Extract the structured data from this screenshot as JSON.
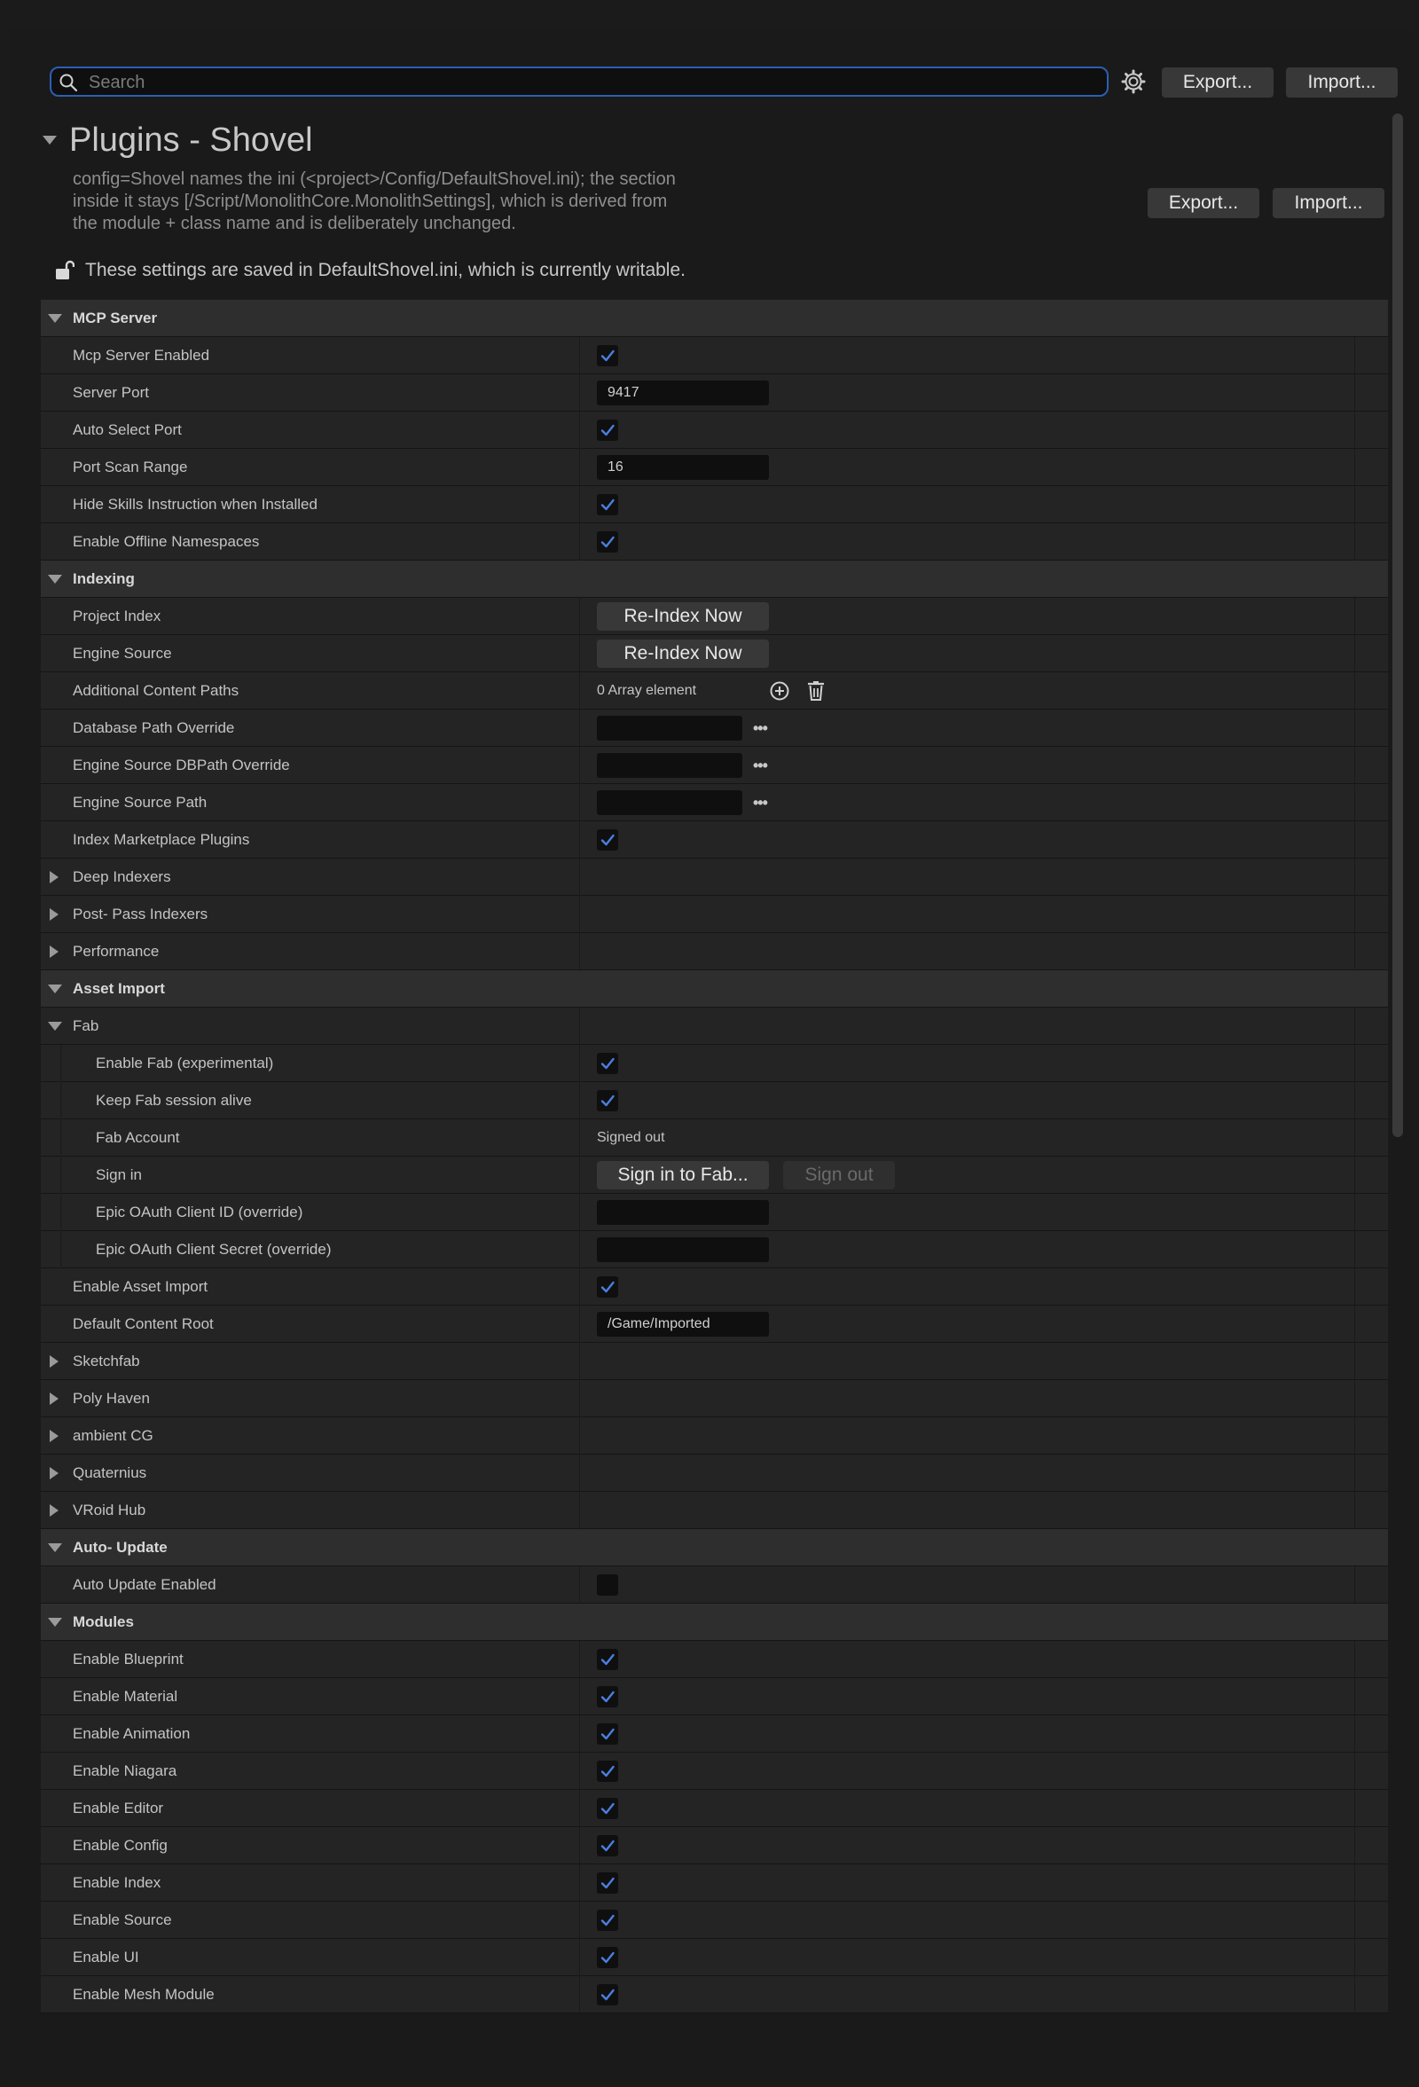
{
  "search": {
    "placeholder": "Search",
    "value": ""
  },
  "toolbar": {
    "export_label": "Export...",
    "import_label": "Import..."
  },
  "header": {
    "title": "Plugins - Shovel",
    "description_lines": [
      "config=Shovel names the ini (<project>/Config/DefaultShovel.ini); the section",
      "inside it stays [/Script/MonolithCore.MonolithSettings], which is derived from",
      "the module + class name and is deliberately unchanged."
    ],
    "export_label": "Export...",
    "import_label": "Import...",
    "saved_note": "These settings are saved in DefaultShovel.ini, which is currently writable."
  },
  "colors": {
    "accent": "#2c5fb3",
    "check": "#4a7fe0"
  },
  "rows": [
    {
      "type": "category",
      "label": "MCP Server",
      "expanded": true
    },
    {
      "type": "checkbox",
      "label": "Mcp Server Enabled",
      "checked": true
    },
    {
      "type": "text",
      "label": "Server Port",
      "value": "9417"
    },
    {
      "type": "checkbox",
      "label": "Auto Select Port",
      "checked": true
    },
    {
      "type": "text",
      "label": "Port Scan Range",
      "value": "16"
    },
    {
      "type": "checkbox",
      "label": "Hide Skills Instruction when Installed",
      "checked": true
    },
    {
      "type": "checkbox",
      "label": "Enable Offline Namespaces",
      "checked": true
    },
    {
      "type": "category",
      "label": "Indexing",
      "expanded": true
    },
    {
      "type": "button",
      "label": "Project Index",
      "button": "Re-Index Now"
    },
    {
      "type": "button",
      "label": "Engine Source",
      "button": "Re-Index Now"
    },
    {
      "type": "array",
      "label": "Additional Content Paths",
      "value": "0 Array element"
    },
    {
      "type": "path",
      "label": "Database Path Override"
    },
    {
      "type": "path",
      "label": "Engine Source DBPath Override"
    },
    {
      "type": "path",
      "label": "Engine Source Path"
    },
    {
      "type": "checkbox",
      "label": "Index Marketplace Plugins",
      "checked": true
    },
    {
      "type": "group",
      "label": "Deep Indexers",
      "expanded": false
    },
    {
      "type": "group",
      "label": "Post- Pass Indexers",
      "expanded": false
    },
    {
      "type": "group",
      "label": "Performance",
      "expanded": false
    },
    {
      "type": "category",
      "label": "Asset Import",
      "expanded": true
    },
    {
      "type": "group",
      "label": "Fab",
      "expanded": true
    },
    {
      "type": "checkbox",
      "label": "Enable Fab (experimental)",
      "checked": true,
      "indent": 1
    },
    {
      "type": "checkbox",
      "label": "Keep Fab session alive",
      "checked": true,
      "indent": 1
    },
    {
      "type": "plain",
      "label": "Fab Account",
      "value": "Signed out",
      "indent": 1
    },
    {
      "type": "signin",
      "label": "Sign in",
      "button": "Sign in to Fab...",
      "button2": "Sign out",
      "indent": 1
    },
    {
      "type": "text",
      "label": "Epic OAuth Client ID (override)",
      "value": "",
      "indent": 1
    },
    {
      "type": "text",
      "label": "Epic OAuth Client Secret (override)",
      "value": "",
      "indent": 1
    },
    {
      "type": "checkbox",
      "label": "Enable Asset Import",
      "checked": true
    },
    {
      "type": "text",
      "label": "Default Content Root",
      "value": "/Game/Imported"
    },
    {
      "type": "group",
      "label": "Sketchfab",
      "expanded": false
    },
    {
      "type": "group",
      "label": "Poly Haven",
      "expanded": false
    },
    {
      "type": "group",
      "label": "ambient CG",
      "expanded": false
    },
    {
      "type": "group",
      "label": "Quaternius",
      "expanded": false
    },
    {
      "type": "group",
      "label": "VRoid Hub",
      "expanded": false
    },
    {
      "type": "category",
      "label": "Auto- Update",
      "expanded": true
    },
    {
      "type": "checkbox",
      "label": "Auto Update Enabled",
      "checked": false
    },
    {
      "type": "category",
      "label": "Modules",
      "expanded": true
    },
    {
      "type": "checkbox",
      "label": "Enable Blueprint",
      "checked": true
    },
    {
      "type": "checkbox",
      "label": "Enable Material",
      "checked": true
    },
    {
      "type": "checkbox",
      "label": "Enable Animation",
      "checked": true
    },
    {
      "type": "checkbox",
      "label": "Enable Niagara",
      "checked": true
    },
    {
      "type": "checkbox",
      "label": "Enable Editor",
      "checked": true
    },
    {
      "type": "checkbox",
      "label": "Enable Config",
      "checked": true
    },
    {
      "type": "checkbox",
      "label": "Enable Index",
      "checked": true
    },
    {
      "type": "checkbox",
      "label": "Enable Source",
      "checked": true
    },
    {
      "type": "checkbox",
      "label": "Enable UI",
      "checked": true
    },
    {
      "type": "checkbox",
      "label": "Enable Mesh Module",
      "checked": true
    }
  ]
}
